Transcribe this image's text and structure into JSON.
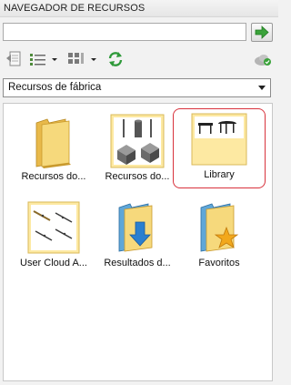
{
  "panel": {
    "title": "NAVEGADOR DE RECURSOS"
  },
  "search": {
    "value": "",
    "placeholder": "",
    "go_icon": "green-arrow-right-icon"
  },
  "toolbar": {
    "items": [
      {
        "icon": "back-document-icon"
      },
      {
        "icon": "list-view-icon"
      },
      {
        "icon": "thumbnail-view-icon"
      },
      {
        "icon": "refresh-icon"
      },
      {
        "icon": "cloud-status-icon"
      }
    ]
  },
  "source_select": {
    "selected": "Recursos de fábrica"
  },
  "tiles": [
    {
      "label": "Recursos do...",
      "icon": "folder-icon",
      "selected": false
    },
    {
      "label": "Recursos do...",
      "icon": "content-library-icon",
      "selected": false
    },
    {
      "label": "Library",
      "icon": "library-icon",
      "selected": true
    },
    {
      "label": "User Cloud A...",
      "icon": "user-cloud-assets-icon",
      "selected": false
    },
    {
      "label": "Resultados d...",
      "icon": "download-folder-icon",
      "selected": false
    },
    {
      "label": "Favoritos",
      "icon": "favorites-folder-icon",
      "selected": false
    }
  ],
  "colors": {
    "selection_outline": "#d8323c",
    "go_arrow": "#3aa23a",
    "thumb_bg": "#fde9a2"
  }
}
